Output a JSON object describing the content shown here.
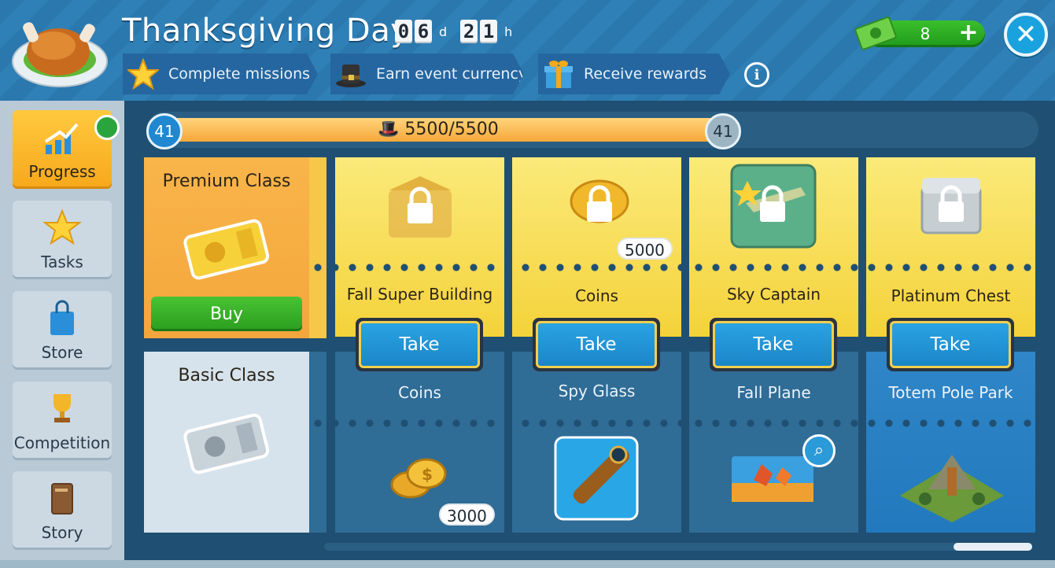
{
  "header": {
    "title": "Thanksgiving Day",
    "timer": {
      "days_digits": [
        "0",
        "6"
      ],
      "days_unit": "d",
      "hours_digits": [
        "2",
        "1"
      ],
      "hours_unit": "h"
    },
    "steps": [
      {
        "label": "Complete missions",
        "icon": "star-icon"
      },
      {
        "label": "Earn event currency",
        "icon": "pilgrim-hat-icon"
      },
      {
        "label": "Receive rewards",
        "icon": "gift-icon"
      }
    ],
    "info_icon": "i",
    "cash_value": "8",
    "plus": "+",
    "close": "✕"
  },
  "sidebar": {
    "items": [
      {
        "label": "Progress",
        "icon": "progress-chart-icon",
        "active": true
      },
      {
        "label": "Tasks",
        "icon": "star-icon"
      },
      {
        "label": "Store",
        "icon": "shopping-bag-icon"
      },
      {
        "label": "Competition",
        "icon": "trophy-icon"
      },
      {
        "label": "Story",
        "icon": "book-icon"
      }
    ]
  },
  "progress": {
    "level_left": "41",
    "level_right": "41",
    "text": "5500/5500",
    "fraction": 1.0
  },
  "classes": {
    "premium": {
      "title": "Premium Class",
      "buy_label": "Buy"
    },
    "basic": {
      "title": "Basic Class"
    }
  },
  "columns": [
    {
      "premium_name": "Fall Super Building",
      "premium_icon": "locked-building-icon",
      "take_label": "Take",
      "basic_name": "Coins",
      "basic_icon": "coins-icon",
      "basic_count": "3000"
    },
    {
      "premium_name": "Coins",
      "premium_icon": "locked-coins-icon",
      "premium_count": "5000",
      "take_label": "Take",
      "basic_name": "Spy Glass",
      "basic_icon": "spyglass-icon"
    },
    {
      "premium_name": "Sky Captain",
      "premium_icon": "locked-plane-icon",
      "take_label": "Take",
      "basic_name": "Fall Plane",
      "basic_icon": "fall-plane-icon"
    },
    {
      "premium_name": "Platinum Chest",
      "premium_icon": "locked-chest-icon",
      "take_label": "Take",
      "basic_name": "Totem Pole Park",
      "basic_icon": "totem-park-icon"
    }
  ],
  "colors": {
    "accent_gold": "#f4d23a",
    "take_blue": "#1a86c8",
    "buy_green": "#2a9d1f",
    "header_blue": "#2a78ae"
  }
}
